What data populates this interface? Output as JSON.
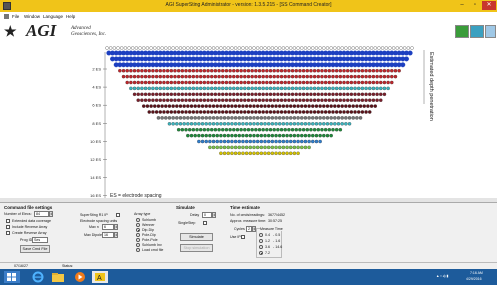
{
  "window": {
    "title": "AGI SuperSting Administrator - version: 1.3.5.215 - [SS Command Creator]",
    "minimize": "–",
    "maximize": "▫",
    "close": "✕"
  },
  "menu": {
    "items": [
      "File",
      "Window",
      "Language",
      "Help"
    ]
  },
  "logo": {
    "mark": "★",
    "text": "AGI",
    "line1": "Advanced",
    "line2": "Geosciences, Inc."
  },
  "toolbar": {
    "icons": [
      "ground-view-icon",
      "grid-icon",
      "menu-icon"
    ]
  },
  "chart_data": {
    "type": "scatter",
    "title": "",
    "ylabel": "Estimated depth penetration",
    "xlabel": "",
    "y_ticks": [
      "2 ES",
      "4 ES",
      "6 ES",
      "8 ES",
      "10 ES",
      "12 ES",
      "14 ES",
      "16 ES"
    ],
    "legend_text": "ES = electrode spacing",
    "top_row": "electrodes",
    "electrode_count": 84,
    "rows": [
      {
        "level": 1,
        "points": 83,
        "color": "#1c3fc0"
      },
      {
        "level": 2,
        "points": 81,
        "color": "#1c3fc0"
      },
      {
        "level": 3,
        "points": 79,
        "color": "#1c3fc0"
      },
      {
        "level": 4,
        "points": 77,
        "color": "#c0262b"
      },
      {
        "level": 5,
        "points": 75,
        "color": "#c0262b"
      },
      {
        "level": 6,
        "points": 73,
        "color": "#c0262b"
      },
      {
        "level": 7,
        "points": 71,
        "color": "#3bb4be"
      },
      {
        "level": 8,
        "points": 69,
        "color": "#7a1e2a"
      },
      {
        "level": 9,
        "points": 67,
        "color": "#7a1e2a"
      },
      {
        "level": 10,
        "points": 64,
        "color": "#5a1118"
      },
      {
        "level": 11,
        "points": 61,
        "color": "#5a1118"
      },
      {
        "level": 12,
        "points": 56,
        "color": "#777777"
      },
      {
        "level": 13,
        "points": 50,
        "color": "#3bb4be"
      },
      {
        "level": 14,
        "points": 45,
        "color": "#1f8a3a"
      },
      {
        "level": 15,
        "points": 40,
        "color": "#1f8a3a"
      },
      {
        "level": 16,
        "points": 34,
        "color": "#2f7fcf"
      },
      {
        "level": 17,
        "points": 28,
        "color": "#7bc34a"
      },
      {
        "level": 18,
        "points": 22,
        "color": "#d6c400"
      }
    ],
    "grid": false
  },
  "command_file": {
    "title": "Command file settings",
    "num_elec_label": "Number of Elecs:",
    "num_elec_value": "84",
    "extended_label": "Extended data coverage",
    "reverse_label": "Include Reverse Array",
    "create_reverse_label": "Create Reverse Array",
    "prog_label": "Prog ID",
    "prog_value": "Ses",
    "save_button": "Save Cmd File"
  },
  "supersting": {
    "rx_label": "SuperSting R1 IP",
    "spacing_label": "Electrode spacing units",
    "max_n_label": "Max n",
    "max_n_value": "6",
    "max_dipole_label": "Max Dipole",
    "max_dipole_value": "16"
  },
  "array_type": {
    "label": "Array type",
    "options": [
      {
        "label": "Schlumb",
        "selected": false
      },
      {
        "label": "Wenner",
        "selected": false
      },
      {
        "label": "Dip-Dip",
        "selected": true
      },
      {
        "label": "Pole-Dip",
        "selected": false
      },
      {
        "label": "Pole-Pole",
        "selected": false
      },
      {
        "label": "Schlumb Inv",
        "selected": false
      },
      {
        "label": "Load cmd file",
        "selected": false
      }
    ]
  },
  "simulate": {
    "title": "Simulate",
    "delay_label": "Delay",
    "delay_value": "0",
    "single_step_label": "SingleStep",
    "simulate_button": "Simulate",
    "stop_button": "Stop simulation"
  },
  "time_estimate": {
    "title": "Time estimate",
    "readings_label": "No. of cmds/readings:",
    "readings_value": "3677/4452",
    "measure_label": "Approx. measure time:",
    "measure_value": "30:57:25",
    "cycles_label": "Cycles",
    "cycles_value": "2",
    "use_ip_label": "Use IP",
    "measure_time_label": "Measure Time",
    "measure_times": [
      {
        "label": "0.4",
        "selected": false,
        "value": "0.5"
      },
      {
        "label": "1.2",
        "selected": false,
        "value": "1.6"
      },
      {
        "label": "3.6",
        "selected": false,
        "value": "14.6"
      },
      {
        "label": "7.2",
        "selected": true,
        "value": ""
      }
    ]
  },
  "status": {
    "date": "07/16/27",
    "label": "Status:"
  },
  "taskbar": {
    "apps": [
      "windows-start-icon",
      "internet-explorer-icon",
      "file-explorer-icon",
      "media-player-icon",
      "agi-app-icon"
    ],
    "time": "7:16 AM",
    "date": "4/29/2016"
  }
}
